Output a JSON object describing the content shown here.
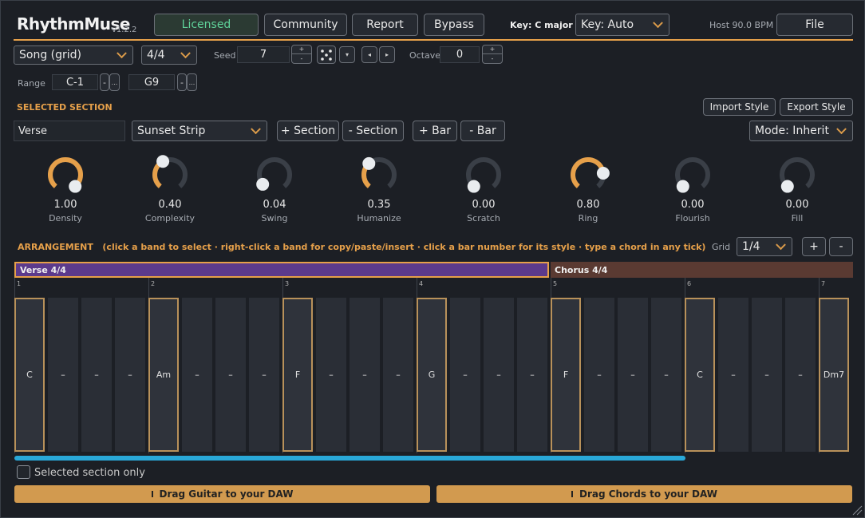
{
  "header": {
    "app_title": "RhythmMuse",
    "version": "v1.2.2",
    "licensed_label": "Licensed",
    "community_label": "Community",
    "report_label": "Report",
    "bypass_label": "Bypass",
    "key_label": "Key: C major",
    "key_select": "Key: Auto",
    "host_bpm": "Host 90.0 BPM",
    "file_label": "File"
  },
  "row2": {
    "mode_select": "Song (grid)",
    "meter_select": "4/4",
    "seed_label": "Seed",
    "seed_value": "7",
    "octave_label": "Octave",
    "octave_value": "0"
  },
  "range": {
    "label": "Range",
    "low": "C-1",
    "high": "G9",
    "minus": "-",
    "more": "..."
  },
  "section": {
    "heading": "SELECTED SECTION",
    "import_label": "Import Style",
    "export_label": "Export Style",
    "name_value": "Verse",
    "style_select": "Sunset Strip",
    "add_section": "+ Section",
    "remove_section": "- Section",
    "add_bar": "+ Bar",
    "remove_bar": "- Bar",
    "mode_select": "Mode: Inherit"
  },
  "knobs": [
    {
      "value": "1.00",
      "name": "Density",
      "level": 1.0
    },
    {
      "value": "0.40",
      "name": "Complexity",
      "level": 0.4
    },
    {
      "value": "0.04",
      "name": "Swing",
      "level": 0.04
    },
    {
      "value": "0.35",
      "name": "Humanize",
      "level": 0.35
    },
    {
      "value": "0.00",
      "name": "Scratch",
      "level": 0.0
    },
    {
      "value": "0.80",
      "name": "Ring",
      "level": 0.8
    },
    {
      "value": "0.00",
      "name": "Flourish",
      "level": 0.0
    },
    {
      "value": "0.00",
      "name": "Fill",
      "level": 0.0
    }
  ],
  "arrangement": {
    "heading": "ARRANGEMENT",
    "hint": "(click a band to select · right-click a band for copy/paste/insert · click a bar number for its style · type a chord in any tick)",
    "grid_label": "Grid",
    "grid_select": "1/4",
    "plus": "+",
    "minus": "-",
    "bands": [
      {
        "label": "Verse  4/4"
      },
      {
        "label": "Chorus  4/4"
      }
    ],
    "bar_numbers": [
      "1",
      "2",
      "3",
      "4",
      "5",
      "6",
      "7"
    ],
    "ticks": [
      "C",
      "–",
      "–",
      "–",
      "Am",
      "–",
      "–",
      "–",
      "F",
      "–",
      "–",
      "–",
      "G",
      "–",
      "–",
      "–",
      "F",
      "–",
      "–",
      "–",
      "C",
      "–",
      "–",
      "–",
      "Dm7"
    ],
    "scroll_fraction": 0.8
  },
  "footer": {
    "selected_only": "Selected section only",
    "drag_guitar": "Drag Guitar to your DAW",
    "drag_chords": "Drag Chords to your DAW"
  },
  "colors": {
    "accent": "#e6a04a",
    "verse_band": "#5c3a8c",
    "chorus_band": "#5a3a32",
    "scroll": "#29a8d8",
    "licensed": "#5fd39a"
  }
}
